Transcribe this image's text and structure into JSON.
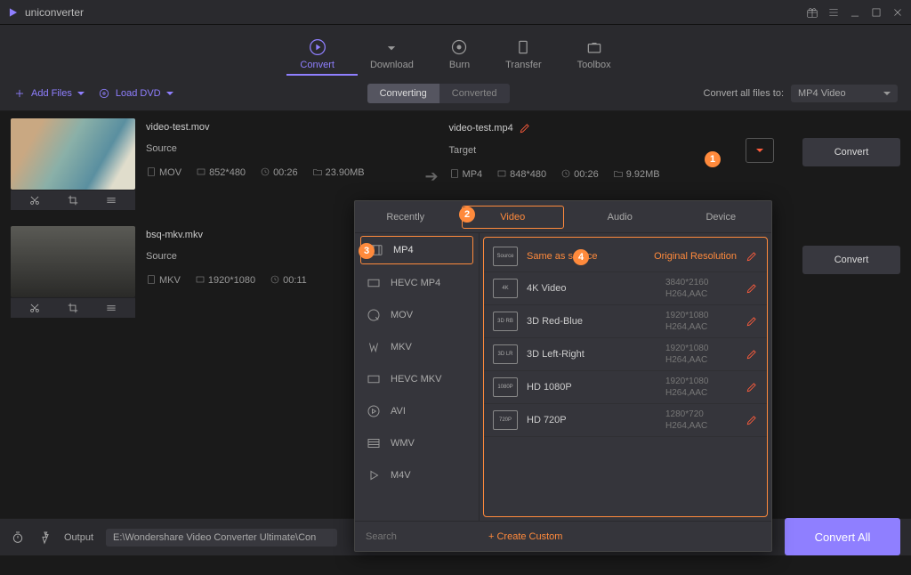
{
  "app": {
    "name": "uniconverter"
  },
  "nav": {
    "convert": "Convert",
    "download": "Download",
    "burn": "Burn",
    "transfer": "Transfer",
    "toolbox": "Toolbox"
  },
  "toolbar": {
    "add_files": "Add Files",
    "load_dvd": "Load DVD",
    "converting_tab": "Converting",
    "converted_tab": "Converted",
    "convert_all_to": "Convert all files to:",
    "target_format": "MP4 Video"
  },
  "files": [
    {
      "name": "video-test.mov",
      "source_label": "Source",
      "src": {
        "container": "MOV",
        "dim": "852*480",
        "dur": "00:26",
        "size": "23.90MB"
      },
      "target_name": "video-test.mp4",
      "target_label": "Target",
      "tgt": {
        "container": "MP4",
        "dim": "848*480",
        "dur": "00:26",
        "size": "9.92MB"
      },
      "convert": "Convert"
    },
    {
      "name": "bsq-mkv.mkv",
      "source_label": "Source",
      "src": {
        "container": "MKV",
        "dim": "1920*1080",
        "dur": "00:11"
      },
      "convert": "Convert"
    }
  ],
  "bottom": {
    "output_label": "Output",
    "output_path": "E:\\Wondershare Video Converter Ultimate\\Con",
    "convert_all": "Convert All"
  },
  "popover": {
    "tabs": {
      "recently": "Recently",
      "video": "Video",
      "audio": "Audio",
      "device": "Device"
    },
    "formats": [
      "MP4",
      "HEVC MP4",
      "MOV",
      "MKV",
      "HEVC MKV",
      "AVI",
      "WMV",
      "M4V"
    ],
    "resolutions": [
      {
        "icon": "Source",
        "title": "Same as source",
        "sub": "Original Resolution",
        "hl": true
      },
      {
        "icon": "4K",
        "title": "4K Video",
        "sub": "3840*2160",
        "codec": "H264,AAC"
      },
      {
        "icon": "3D RB",
        "title": "3D Red-Blue",
        "sub": "1920*1080",
        "codec": "H264,AAC"
      },
      {
        "icon": "3D LR",
        "title": "3D Left-Right",
        "sub": "1920*1080",
        "codec": "H264,AAC"
      },
      {
        "icon": "1080P",
        "title": "HD 1080P",
        "sub": "1920*1080",
        "codec": "H264,AAC"
      },
      {
        "icon": "720P",
        "title": "HD 720P",
        "sub": "1280*720",
        "codec": "H264,AAC"
      }
    ],
    "search_placeholder": "Search",
    "create_custom": "Create Custom"
  },
  "callouts": {
    "c1": "1",
    "c2": "2",
    "c3": "3",
    "c4": "4"
  }
}
